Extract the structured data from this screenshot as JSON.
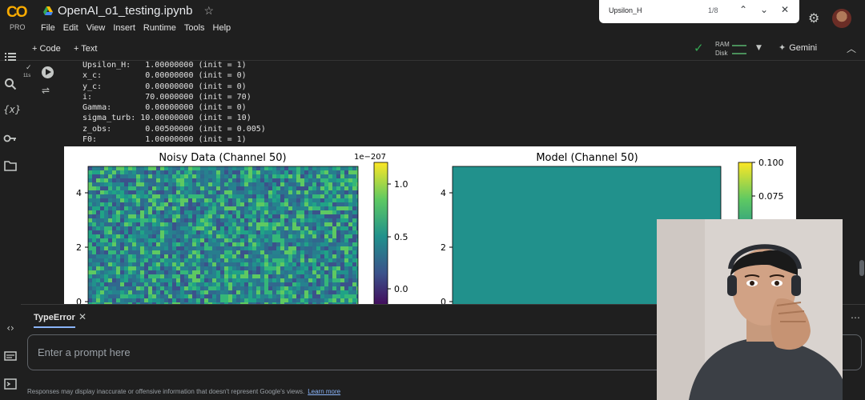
{
  "app": {
    "logo_text": "CO",
    "plan": "PRO",
    "notebook_title": "OpenAI_o1_testing.ipynb"
  },
  "menu": [
    "File",
    "Edit",
    "View",
    "Insert",
    "Runtime",
    "Tools",
    "Help"
  ],
  "find": {
    "query": "Upsilon_H",
    "count": "1/8"
  },
  "toolbar": {
    "add_code": "+ Code",
    "add_text": "+ Text",
    "ram_label": "RAM",
    "disk_label": "Disk",
    "gemini_label": "Gemini"
  },
  "cell": {
    "exec_time": "11s"
  },
  "output_lines": [
    "Upsilon_H:   1.00000000 (init = 1)",
    "x_c:         0.00000000 (init = 0)",
    "y_c:         0.00000000 (init = 0)",
    "i:           70.0000000 (init = 70)",
    "Gamma:       0.00000000 (init = 0)",
    "sigma_turb: 10.00000000 (init = 10)",
    "z_obs:       0.00500000 (init = 0.005)",
    "F0:          1.00000000 (init = 1)"
  ],
  "chart_data": [
    {
      "type": "heatmap",
      "title": "Noisy Data (Channel 50)",
      "yticks": [
        "4",
        "2",
        "0"
      ],
      "colorbar": {
        "offset_label": "1e−207",
        "ticks": [
          "1.0",
          "0.5",
          "0.0"
        ]
      }
    },
    {
      "type": "heatmap",
      "title": "Model (Channel 50)",
      "yticks": [
        "4",
        "2",
        "0"
      ],
      "colorbar": {
        "ticks": [
          "0.100",
          "0.075"
        ]
      }
    }
  ],
  "bottom": {
    "tab_label": "TypeError",
    "prompt_placeholder": "Enter a prompt here",
    "disclaimer": "Responses may display inaccurate or offensive information that doesn't represent Google's views.",
    "learn_more": "Learn more"
  },
  "icons": {
    "rail": [
      "toc-icon",
      "search-icon",
      "variables-icon",
      "secrets-icon",
      "files-icon",
      "code-snippets-icon",
      "command-palette-icon",
      "terminal-icon"
    ]
  },
  "colors": {
    "background": "#1f1f1f",
    "accent": "#8ab4f8",
    "check": "#34a853",
    "logo": "#f9ab00",
    "viridis_teal": "#21918c"
  }
}
